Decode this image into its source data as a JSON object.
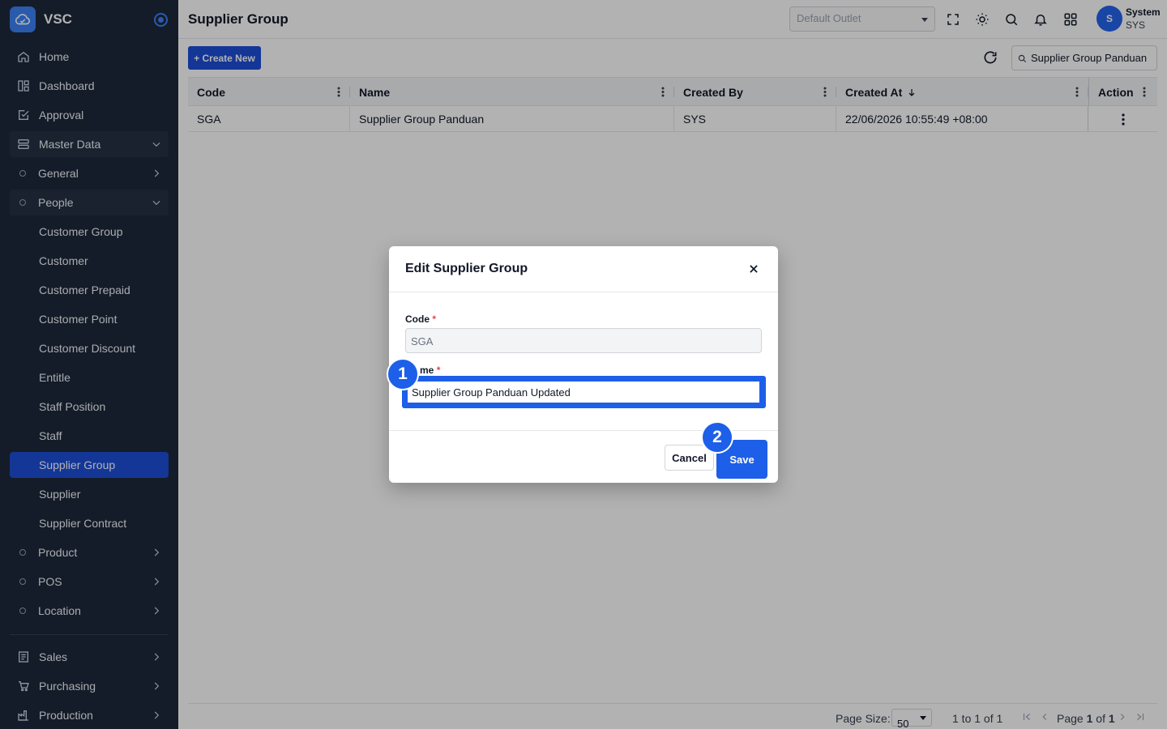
{
  "app": {
    "name": "VSC"
  },
  "sidebar": {
    "items": [
      {
        "label": "Home"
      },
      {
        "label": "Dashboard"
      },
      {
        "label": "Approval"
      },
      {
        "label": "Master Data"
      },
      {
        "label": "General"
      },
      {
        "label": "People"
      },
      {
        "label": "Customer Group"
      },
      {
        "label": "Customer"
      },
      {
        "label": "Customer Prepaid"
      },
      {
        "label": "Customer Point"
      },
      {
        "label": "Customer Discount"
      },
      {
        "label": "Entitle"
      },
      {
        "label": "Staff Position"
      },
      {
        "label": "Staff"
      },
      {
        "label": "Supplier Group"
      },
      {
        "label": "Supplier"
      },
      {
        "label": "Supplier Contract"
      },
      {
        "label": "Product"
      },
      {
        "label": "POS"
      },
      {
        "label": "Location"
      },
      {
        "label": "Sales"
      },
      {
        "label": "Purchasing"
      },
      {
        "label": "Production"
      }
    ]
  },
  "header": {
    "title": "Supplier Group",
    "outlet_placeholder": "Default Outlet",
    "user_initial": "S",
    "user_name": "System",
    "user_code": "SYS"
  },
  "toolbar": {
    "create_label": "+ Create New",
    "search_value": "Supplier Group Panduan"
  },
  "table": {
    "columns": [
      "Code",
      "Name",
      "Created By",
      "Created At",
      "Action"
    ],
    "rows": [
      {
        "code": "SGA",
        "name": "Supplier Group Panduan",
        "created_by": "SYS",
        "created_at": "22/06/2026 10:55:49 +08:00"
      }
    ]
  },
  "footer": {
    "page_size_label": "Page Size:",
    "page_size": "50",
    "range": "1 to 1 of 1",
    "page_prefix": "Page",
    "page_current": "1",
    "page_of": "of",
    "page_total": "1"
  },
  "dialog": {
    "title": "Edit Supplier Group",
    "code_label": "Code",
    "code_value": "SGA",
    "name_label": "Name",
    "name_label_visible": "me",
    "name_value": "Supplier Group Panduan Updated",
    "required_mark": "*",
    "cancel_label": "Cancel",
    "save_label": "Save"
  },
  "annotations": {
    "step1": "1",
    "step2": "2"
  },
  "colors": {
    "sidebar_bg": "#1e293b",
    "accent": "#1d4ed8",
    "highlight": "#1d5fe8"
  }
}
